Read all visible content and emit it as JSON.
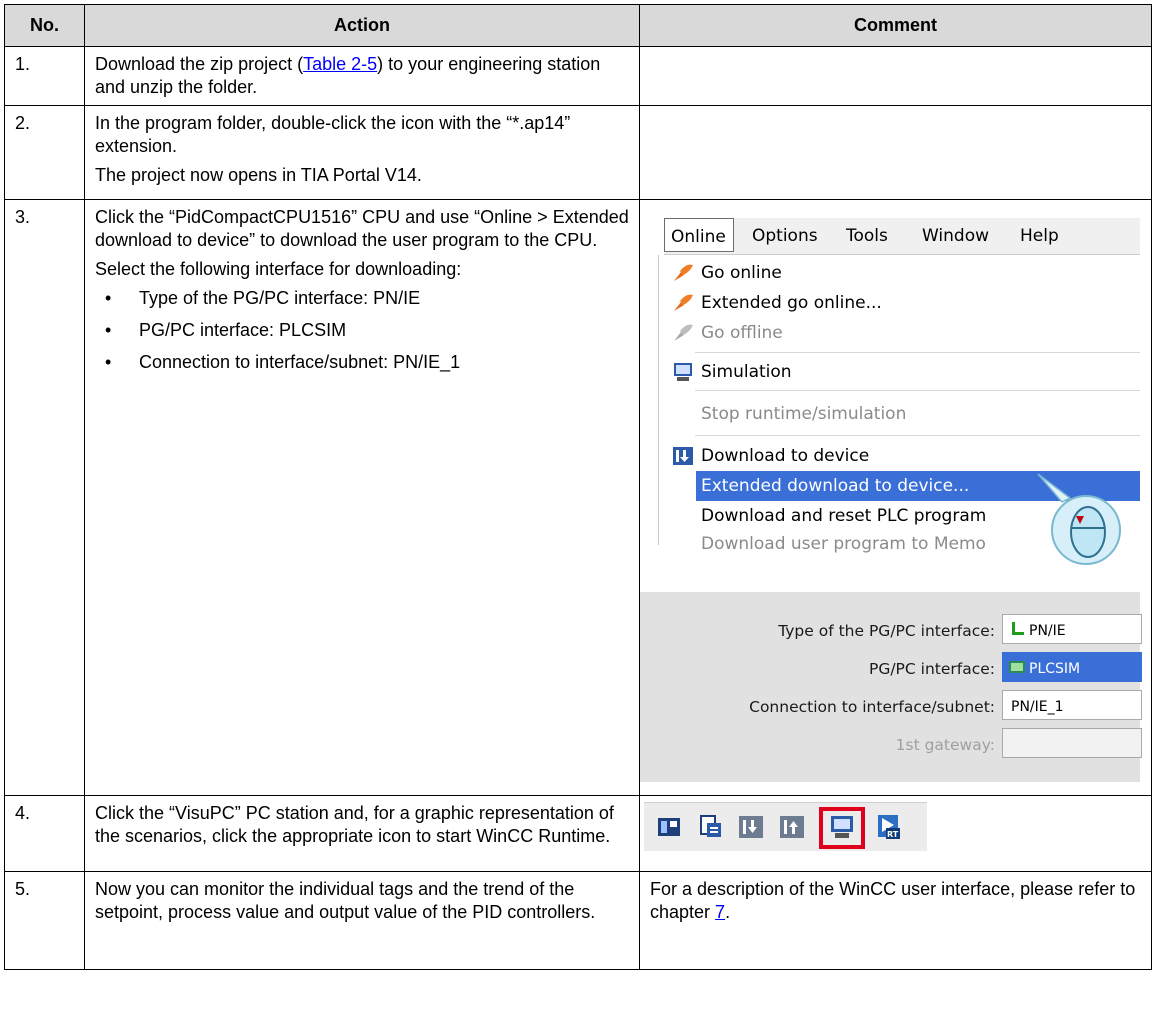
{
  "header": {
    "no": "No.",
    "action": "Action",
    "comment": "Comment"
  },
  "rows": [
    {
      "no": "1.",
      "action_pre": "Download the zip project (",
      "action_link": "Table 2-5",
      "action_post": ") to your engineering station and unzip the folder."
    },
    {
      "no": "2.",
      "action_p1": "In the program folder, double-click the icon with the “*.ap14” extension.",
      "action_p2": "The project now opens in TIA Portal V14."
    },
    {
      "no": "3.",
      "action_p1": "Click the “PidCompactCPU1516” CPU and use “Online > Extended download to device” to download the user program to the CPU.",
      "action_p2": "Select the following interface for downloading:",
      "bullets": [
        "Type of the PG/PC interface: PN/IE",
        "PG/PC interface: PLCSIM",
        "Connection to interface/subnet: PN/IE_1"
      ]
    },
    {
      "no": "4.",
      "action": "Click the “VisuPC” PC station and, for a graphic representation of the scenarios, click the appropriate icon to start WinCC Runtime."
    },
    {
      "no": "5.",
      "action": "Now you can monitor the individual tags and the trend of the setpoint, process value and output value of the PID controllers.",
      "comment_pre": "For a description of the WinCC user interface, please refer to chapter ",
      "comment_link": "7",
      "comment_post": "."
    }
  ],
  "menu": {
    "bar": [
      "Online",
      "Options",
      "Tools",
      "Window",
      "Help"
    ],
    "items": [
      {
        "label": "Go online",
        "icon": "go-online-icon",
        "disabled": false
      },
      {
        "label": "Extended go online...",
        "icon": "go-online-icon",
        "disabled": false
      },
      {
        "label": "Go offline",
        "icon": "go-offline-icon",
        "disabled": true
      },
      {
        "label": "Simulation",
        "icon": "simulation-icon",
        "disabled": false
      },
      {
        "label": "Stop runtime/simulation",
        "icon": "",
        "disabled": true
      },
      {
        "label": "Download to device",
        "icon": "download-icon",
        "disabled": false
      },
      {
        "label": "Extended download to device...",
        "icon": "",
        "disabled": false,
        "selected": true
      },
      {
        "label": "Download and reset PLC program",
        "icon": "",
        "disabled": false
      },
      {
        "label": "Download user program to Memo",
        "icon": "",
        "disabled": true
      }
    ]
  },
  "dialog": {
    "fields": [
      {
        "label": "Type of the PG/PC interface:",
        "value": "PN/IE",
        "icon": "network-icon"
      },
      {
        "label": "PG/PC interface:",
        "value": "PLCSIM",
        "icon": "plcsim-icon",
        "selected": true
      },
      {
        "label": "Connection to interface/subnet:",
        "value": "PN/IE_1"
      },
      {
        "label": "1st gateway:",
        "value": "",
        "disabled": true
      }
    ]
  },
  "toolbar": {
    "icons": [
      "device-config-icon",
      "compile-icon",
      "download-icon",
      "upload-icon",
      "start-simulation-icon",
      "start-runtime-icon"
    ],
    "highlighted": "start-simulation-icon"
  },
  "colors": {
    "header_bg": "#d9d9d9",
    "link": "#0000ff",
    "menu_highlight": "#3a6fd8",
    "toolbar_highlight": "#e0001b"
  }
}
